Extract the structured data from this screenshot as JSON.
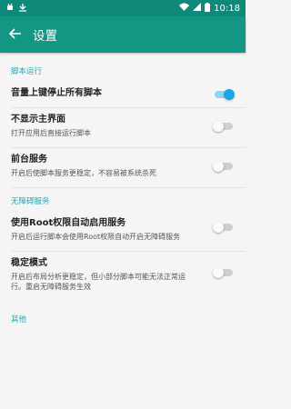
{
  "status_bar": {
    "time": "10:18"
  },
  "app_bar": {
    "title": "设置",
    "back_icon": "arrow-left-icon"
  },
  "sections": {
    "script_run": "脚本运行",
    "accessibility": "无障碍服务",
    "other": "其他"
  },
  "settings": {
    "volume_stop": {
      "title": "音量上键停止所有脚本",
      "subtitle": "",
      "enabled": true
    },
    "hide_main": {
      "title": "不显示主界面",
      "subtitle": "打开应用后直接运行脚本",
      "enabled": false
    },
    "foreground": {
      "title": "前台服务",
      "subtitle": "开启后使脚本服务更稳定，不容易被系统杀死",
      "enabled": false
    },
    "root_enable": {
      "title": "使用Root权限自动启用服务",
      "subtitle": "开启后运行脚本会使用Root权限自动开启无障碍服务",
      "enabled": false
    },
    "stable_mode": {
      "title": "稳定模式",
      "subtitle": "开启后布局分析更稳定，但小部分脚本可能无法正常运行。重启无障碍服务生效",
      "enabled": false
    }
  },
  "colors": {
    "status_bar": "#0f8a7a",
    "app_bar": "#149685",
    "section_header": "#2aa7b3",
    "switch_on": "#19a7e6"
  }
}
